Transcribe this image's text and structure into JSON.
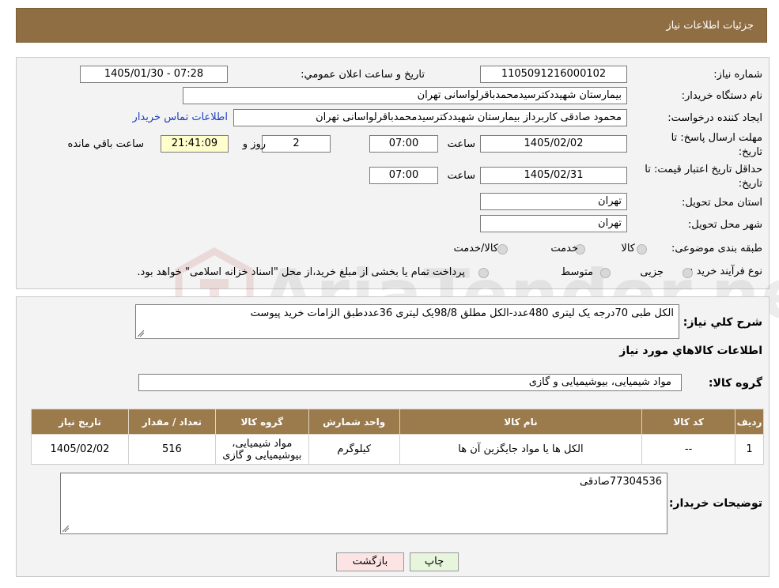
{
  "header": {
    "title": "جزئيات اطلاعات نياز"
  },
  "form": {
    "need_number_label": "شماره نياز:",
    "need_number": "1105091216000102",
    "announce_label": "تاريخ و ساعت اعلان عمومي:",
    "announce_value": "1405/01/30 - 07:28",
    "buyer_org_label": "نام دستگاه خريدار:",
    "buyer_org": "بیمارستان شهیددکترسیدمحمدباقرلواسانی تهران",
    "creator_label": "ايجاد کننده درخواست:",
    "creator": "محمود صادقی کاربرداز بیمارستان شهیددکترسیدمحمدباقرلواسانی تهران",
    "contact_link": "اطلاعات تماس خريدار",
    "deadline_label_1": "مهلت ارسال پاسخ: تا",
    "deadline_label_2": "تاريخ:",
    "deadline_date": "1405/02/02",
    "time_label": "ساعت",
    "deadline_time": "07:00",
    "days_value": "2",
    "days_label": "روز و",
    "remaining_time": "21:41:09",
    "remaining_label": "ساعت باقي مانده",
    "validity_label_1": "حداقل تاريخ اعتبار قيمت: تا",
    "validity_label_2": "تاريخ:",
    "validity_date": "1405/02/31",
    "validity_time": "07:00",
    "province_label": "استان محل تحويل:",
    "province": "تهران",
    "city_label": "شهر محل تحويل:",
    "city": "تهران",
    "category_label": "طبقه بندی موضوعی:",
    "category_options": [
      "کالا",
      "خدمت",
      "کالا/خدمت"
    ],
    "process_label": "نوع فرآيند خريد :",
    "process_options": [
      "جزیی",
      "متوسط"
    ],
    "process_note": "پرداخت تمام یا بخشی از مبلغ خرید،از محل \"اسناد خزانه اسلامی\" خواهد بود."
  },
  "details": {
    "description_label": "شرح کلي نياز:",
    "description": "الکل طبی 70درجه یک لیتری 480عدد-الکل مطلق 98/8یک لیتری 36عددطبق الزامات خرید پیوست",
    "goods_info_title": "اطلاعات کالاهاي مورد نياز",
    "goods_group_label": "گروه کالا:",
    "goods_group": "مواد شیمیایی، بیوشیمیایی و  گازی",
    "table": {
      "headers": [
        "رديف",
        "کد کالا",
        "نام کالا",
        "واحد شمارش",
        "گروه کالا",
        "تعداد / مقدار",
        "تاريخ نياز"
      ],
      "rows": [
        [
          "1",
          "--",
          "الکل ها یا مواد جایگزین آن ها",
          "کیلوگرم",
          "مواد شیمیایی، بیوشیمیایی و گازی",
          "516",
          "1405/02/02"
        ]
      ]
    },
    "buyer_notes_label": "توضيحات خريدار:",
    "buyer_notes": "77304536صادقی"
  },
  "buttons": {
    "print": "چاپ",
    "back": "بازگشت"
  },
  "watermark": {
    "text": "AriaTender.neT"
  },
  "colors": {
    "header_bg": "#8f6e43",
    "table_header_bg": "#9b7a4c",
    "back_button_bg": "#fde4e4",
    "print_button_bg": "#e6f5dc"
  }
}
